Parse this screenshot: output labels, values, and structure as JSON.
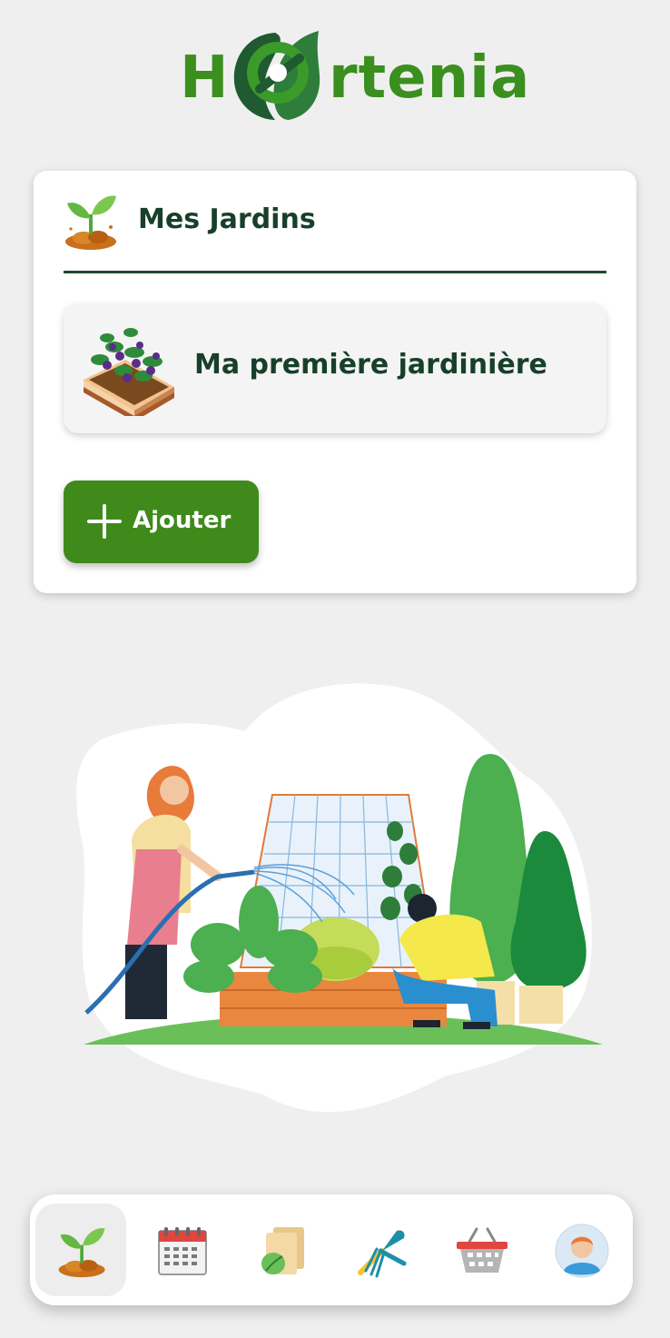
{
  "app": {
    "logo_left": "H",
    "logo_right": "rtenia"
  },
  "colors": {
    "brand_green": "#3a8f1e",
    "dark_green": "#173f2a",
    "button_green": "#3f8a1b"
  },
  "card": {
    "title": "Mes Jardins",
    "title_icon": "sprout-icon",
    "gardens": [
      {
        "name": "Ma première jardinière",
        "icon": "planter-icon"
      }
    ],
    "add_button_label": "Ajouter"
  },
  "navbar": {
    "items": [
      {
        "name": "gardens",
        "icon": "sprout-icon",
        "active": true
      },
      {
        "name": "calendar",
        "icon": "calendar-icon",
        "active": false
      },
      {
        "name": "plant-cards",
        "icon": "plant-cards-icon",
        "active": false
      },
      {
        "name": "tools",
        "icon": "garden-tools-icon",
        "active": false
      },
      {
        "name": "shop",
        "icon": "basket-icon",
        "active": false
      },
      {
        "name": "profile",
        "icon": "user-avatar-icon",
        "active": false
      }
    ]
  }
}
